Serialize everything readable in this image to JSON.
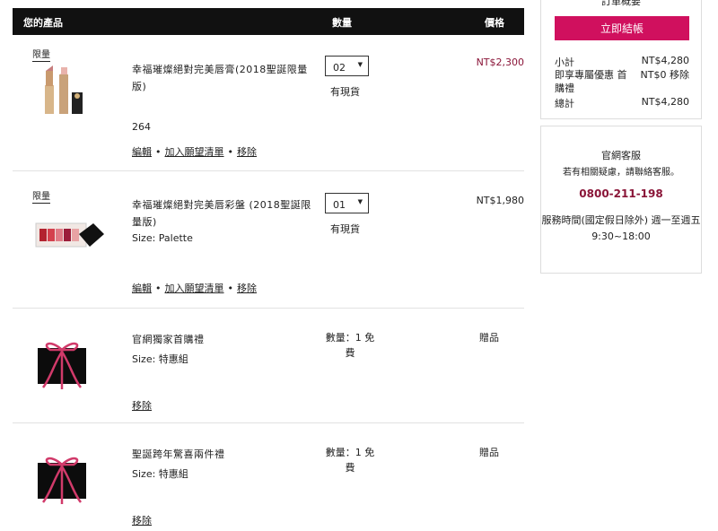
{
  "cart": {
    "header": {
      "product": "您的產品",
      "quantity": "數量",
      "price": "價格"
    },
    "items": [
      {
        "badge": "限量",
        "name": "幸福璀燦絕對完美唇膏(2018聖誕限量版)",
        "sub": "264",
        "qty": "02",
        "stock": "有現貨",
        "price": "NT$2,300",
        "price_color": "#8a1538",
        "edit": "編輯",
        "wishlist": "加入願望清單",
        "remove": "移除",
        "image": "lipstick-image"
      },
      {
        "badge": "限量",
        "name": "幸福璀燦絕對完美唇彩盤 (2018聖誕限量版)",
        "sub": "Size: Palette",
        "qty": "01",
        "stock": "有現貨",
        "price": "NT$1,980",
        "price_color": "#222222",
        "edit": "編輯",
        "wishlist": "加入願望清單",
        "remove": "移除",
        "image": "palette-image"
      },
      {
        "name": "官網獨家首購禮",
        "sub": "Size: 特惠組",
        "qty_text": "數量：1 免費",
        "gift": "贈品",
        "remove": "移除",
        "image": "gift-box-icon"
      },
      {
        "name": "聖誕跨年驚喜兩件禮",
        "sub": "Size: 特惠組",
        "qty_text": "數量：1 免費",
        "gift": "贈品",
        "remove": "移除",
        "image": "gift-box-icon"
      }
    ]
  },
  "summary": {
    "title": "訂單概要",
    "checkout": "立即結帳",
    "subtotal_label": "小計",
    "subtotal": "NT$4,280",
    "discount_label": "即享專屬優惠 首購禮",
    "discount": "NT$0 移除",
    "total_label": "總計",
    "total": "NT$4,280",
    "accent": "#d0105e"
  },
  "service": {
    "title": "官網客服",
    "subtitle": "若有相關疑慮，請聯絡客服。",
    "phone": "0800-211-198",
    "hours": "服務時間(國定假日除外) 週一至週五 9:30~18:00"
  }
}
